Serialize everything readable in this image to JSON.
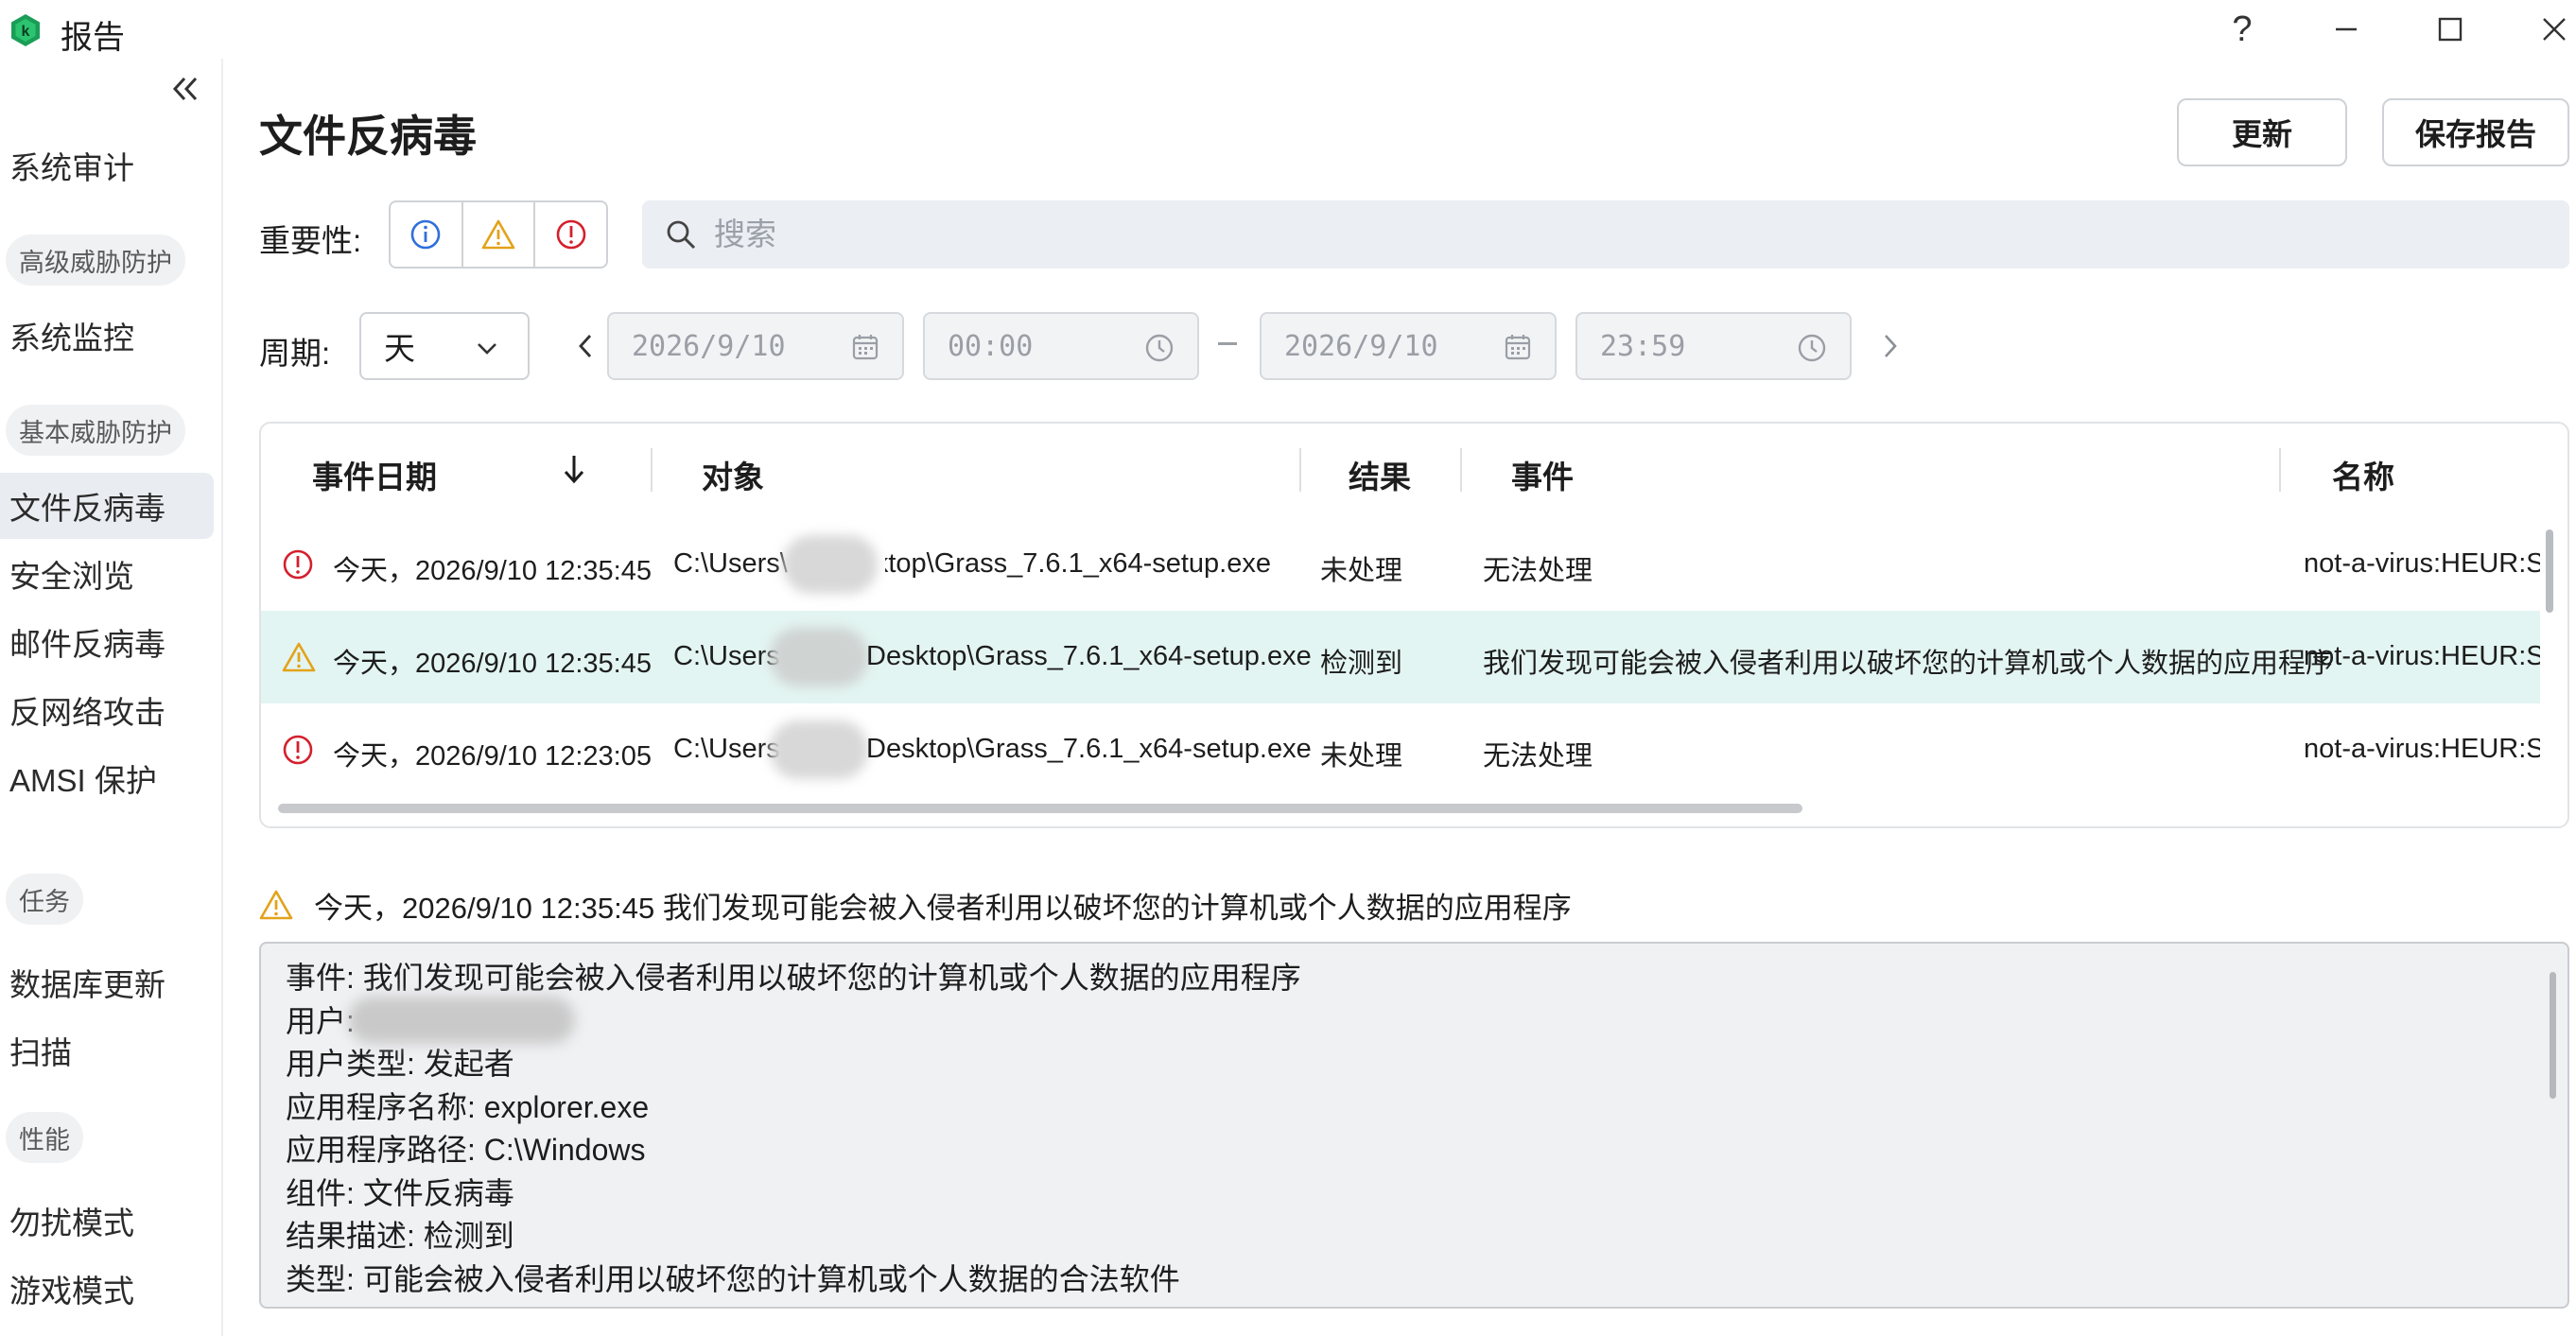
{
  "window": {
    "title": "报告",
    "help_label": "?"
  },
  "sidebar": {
    "items": [
      {
        "type": "item",
        "label": "系统审计"
      },
      {
        "type": "group",
        "label": "高级威胁防护"
      },
      {
        "type": "item",
        "label": "系统监控"
      },
      {
        "type": "group",
        "label": "基本威胁防护"
      },
      {
        "type": "item",
        "label": "文件反病毒",
        "active": true
      },
      {
        "type": "item",
        "label": "安全浏览"
      },
      {
        "type": "item",
        "label": "邮件反病毒"
      },
      {
        "type": "item",
        "label": "反网络攻击"
      },
      {
        "type": "item",
        "label": "AMSI 保护"
      },
      {
        "type": "group",
        "label": "任务"
      },
      {
        "type": "item",
        "label": "数据库更新"
      },
      {
        "type": "item",
        "label": "扫描"
      },
      {
        "type": "group",
        "label": "性能"
      },
      {
        "type": "item",
        "label": "勿扰模式"
      },
      {
        "type": "item",
        "label": "游戏模式"
      }
    ]
  },
  "main": {
    "title": "文件反病毒",
    "refresh_label": "更新",
    "save_label": "保存报告",
    "severity_label": "重要性:",
    "search_placeholder": "搜索",
    "period_label": "周期:",
    "period_value": "天",
    "start_date": "2026/9/10",
    "start_time": "00:00",
    "end_date": "2026/9/10",
    "end_time": "23:59"
  },
  "table": {
    "columns": [
      "事件日期",
      "对象",
      "结果",
      "事件",
      "名称"
    ],
    "rows": [
      {
        "severity": "critical",
        "date": "今天，2026/9/10 12:35:45",
        "object_prefix": "C:\\Users\\",
        "object_suffix": "Desktop\\Grass_7.6.1_x64-setup.exe",
        "result": "未处理",
        "event": "无法处理",
        "name": "not-a-virus:HEUR:Se"
      },
      {
        "severity": "warning",
        "date": "今天，2026/9/10 12:35:45",
        "object_prefix": "C:\\Users",
        "object_suffix": "Desktop\\Grass_7.6.1_x64-setup.exe",
        "result": "检测到",
        "event": "我们发现可能会被入侵者利用以破坏您的计算机或个人数据的应用程序",
        "name": "not-a-virus:HEUR:Se"
      },
      {
        "severity": "critical",
        "date": "今天，2026/9/10 12:23:05",
        "object_prefix": "C:\\Users",
        "object_suffix": "Desktop\\Grass_7.6.1_x64-setup.exe",
        "result": "未处理",
        "event": "无法处理",
        "name": "not-a-virus:HEUR:Se"
      }
    ]
  },
  "detail": {
    "header": "今天，2026/9/10 12:35:45 我们发现可能会被入侵者利用以破坏您的计算机或个人数据的应用程序",
    "lines": [
      "事件: 我们发现可能会被入侵者利用以破坏您的计算机或个人数据的应用程序",
      "用户: ",
      "用户类型: 发起者",
      "应用程序名称: explorer.exe",
      "应用程序路径: C:\\Windows",
      "组件: 文件反病毒",
      "结果描述: 检测到",
      "类型: 可能会被入侵者利用以破坏您的计算机或个人数据的合法软件"
    ]
  },
  "colors": {
    "info": "#2f6fdb",
    "warning": "#e3a21a",
    "critical": "#d4202d",
    "selected_row": "#e3f5f2",
    "brand": "#1a9e57"
  }
}
